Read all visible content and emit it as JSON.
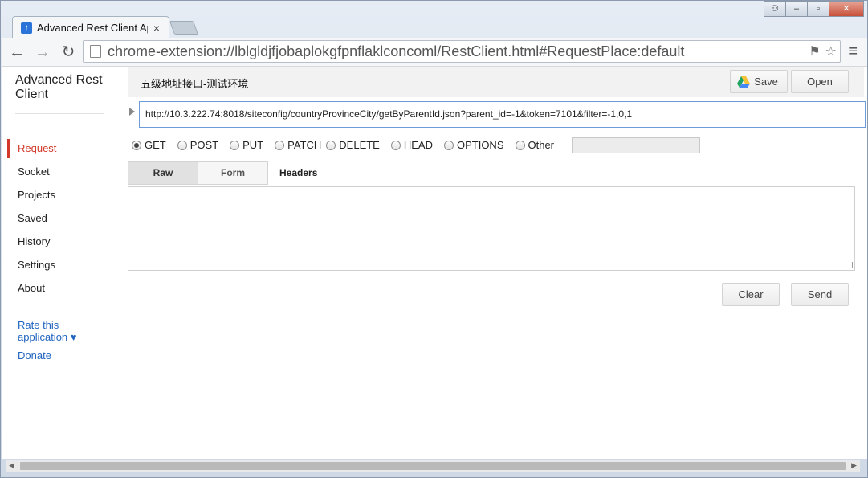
{
  "browser": {
    "tab_title": "Advanced Rest Client Ap",
    "address": "chrome-extension://lblgldjfjobaplokgfpnflaklconcoml/RestClient.html#RequestPlace:default"
  },
  "sidebar": {
    "app_title": "Advanced Rest Client",
    "items": [
      {
        "label": "Request"
      },
      {
        "label": "Socket"
      },
      {
        "label": "Projects"
      },
      {
        "label": "Saved"
      },
      {
        "label": "History"
      },
      {
        "label": "Settings"
      },
      {
        "label": "About"
      }
    ],
    "rate_label": "Rate this application ♥",
    "donate_label": "Donate"
  },
  "header": {
    "project_name": "五级地址接口-测试环境",
    "save_label": "Save",
    "open_label": "Open"
  },
  "request": {
    "url": "http://10.3.222.74:8018/siteconfig/countryProvinceCity/getByParentId.json?parent_id=-1&token=7101&filter=-1,0,1",
    "methods": [
      {
        "label": "GET",
        "checked": true
      },
      {
        "label": "POST"
      },
      {
        "label": "PUT"
      },
      {
        "label": "PATCH"
      },
      {
        "label": "DELETE"
      },
      {
        "label": "HEAD"
      },
      {
        "label": "OPTIONS"
      },
      {
        "label": "Other"
      }
    ],
    "tabs": {
      "raw": "Raw",
      "form": "Form"
    },
    "headers_label": "Headers",
    "clear_label": "Clear",
    "send_label": "Send"
  },
  "colors": {
    "active_nav": "#d2392a",
    "link": "#2165c0",
    "url_border": "#6b9bd8"
  }
}
